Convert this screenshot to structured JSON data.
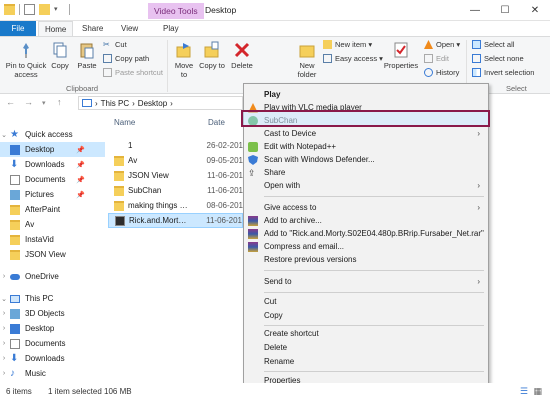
{
  "titlebar": {
    "context_tab": "Video Tools",
    "title": "Desktop",
    "minimize": "—",
    "maximize": "☐",
    "close": "✕"
  },
  "ribbon_tabs": {
    "file": "File",
    "home": "Home",
    "share": "Share",
    "view": "View",
    "play": "Play"
  },
  "ribbon": {
    "pin_quick_access": "Pin to Quick access",
    "copy": "Copy",
    "paste": "Paste",
    "cut": "Cut",
    "copy_path": "Copy path",
    "paste_shortcut": "Paste shortcut",
    "clipboard_group": "Clipboard",
    "move_to": "Move to",
    "copy_to": "Copy to",
    "delete": "Delete",
    "rename": "Rename",
    "organize_group": "Organiz",
    "new_folder": "New folder",
    "new_item": "New item ▾",
    "easy_access": "Easy access ▾",
    "properties": "Properties",
    "open": "Open ▾",
    "edit": "Edit",
    "history": "History",
    "select_all": "Select all",
    "select_none": "Select none",
    "invert_selection": "Invert selection",
    "select_group": "Select"
  },
  "address": {
    "path_this_pc": "This PC",
    "path_desktop": "Desktop",
    "sep": "›"
  },
  "navpane": {
    "items": [
      {
        "label": "Quick access",
        "icon": "star-icon"
      },
      {
        "label": "Desktop",
        "icon": "desktop-icon"
      },
      {
        "label": "Downloads",
        "icon": "download-icon"
      },
      {
        "label": "Documents",
        "icon": "documents-icon"
      },
      {
        "label": "Pictures",
        "icon": "pictures-icon"
      },
      {
        "label": "AfterPaint",
        "icon": "folder-icon"
      },
      {
        "label": "Av",
        "icon": "folder-icon"
      },
      {
        "label": "InstaVid",
        "icon": "folder-icon"
      },
      {
        "label": "JSON View",
        "icon": "folder-icon"
      },
      {
        "label": "OneDrive",
        "icon": "onedrive-icon"
      },
      {
        "label": "This PC",
        "icon": "pc-icon"
      },
      {
        "label": "3D Objects",
        "icon": "3d-objects-icon"
      },
      {
        "label": "Desktop",
        "icon": "desktop-icon"
      },
      {
        "label": "Documents",
        "icon": "documents-icon"
      },
      {
        "label": "Downloads",
        "icon": "download-icon"
      },
      {
        "label": "Music",
        "icon": "music-icon"
      }
    ]
  },
  "filelist": {
    "col_name": "Name",
    "col_date": "Date",
    "rows": [
      {
        "name": "1",
        "date": "26-02-201"
      },
      {
        "name": "Av",
        "date": "09-05-201"
      },
      {
        "name": "JSON View",
        "date": "11-06-201"
      },
      {
        "name": "SubChan",
        "date": "11-06-201"
      },
      {
        "name": "making things simp...",
        "date": "08-06-201"
      },
      {
        "name": "Rick.and.Morty.S02...",
        "date": "11-06-201"
      }
    ]
  },
  "context_menu": {
    "play": "Play",
    "play_vlc": "Play with VLC media player",
    "subchan": "SubChan",
    "cast_to_device": "Cast to Device",
    "edit_notepad": "Edit with Notepad++",
    "scan_defender": "Scan with Windows Defender...",
    "share": "Share",
    "open_with": "Open with",
    "give_access": "Give access to",
    "add_archive": "Add to archive...",
    "add_to_rar": "Add to \"Rick.and.Morty.S02E04.480p.BRrip.Fursaber_Net.rar\"",
    "compress_email": "Compress and email...",
    "restore_versions": "Restore previous versions",
    "send_to": "Send to",
    "cut": "Cut",
    "copy": "Copy",
    "create_shortcut": "Create shortcut",
    "delete": "Delete",
    "rename": "Rename",
    "properties": "Properties"
  },
  "status": {
    "items_count": "6 items",
    "selected": "1 item selected 106 MB"
  },
  "colors": {
    "accent": "#1979ca",
    "selection": "#cce8ff",
    "highlight_border": "#8a1a4a",
    "context_tab": "#e8c2f0"
  }
}
